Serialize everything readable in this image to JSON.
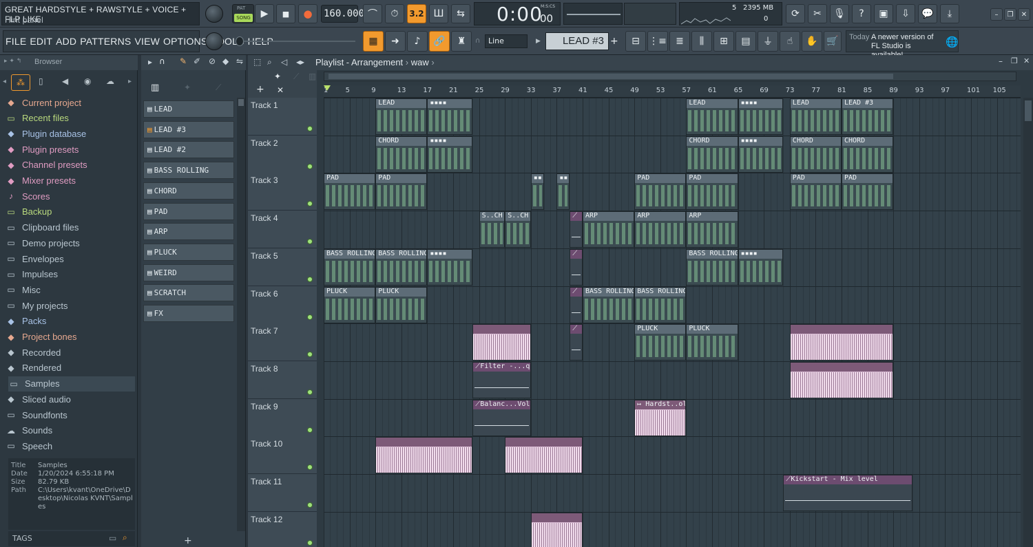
{
  "window": {
    "title": "GREAT HARDSTYLE + RAWSTYLE + VOICE + FLP LIKE",
    "hint": "Hint panel"
  },
  "transport": {
    "pat_label": "PAT",
    "song_label": "SONG",
    "tempo": "160.000",
    "time": "0:00",
    "time_frac": "00",
    "time_unit": "M:S:CS",
    "snap_badge": "3.2",
    "cpu_voices": "5",
    "memory": "2395 MB",
    "memory_sub": "0"
  },
  "menu": [
    "FILE",
    "EDIT",
    "ADD",
    "PATTERNS",
    "VIEW",
    "OPTIONS",
    "TOOLS",
    "HELP"
  ],
  "toolbar": {
    "line_mode": "Line",
    "pattern_selector": "LEAD #3",
    "news_day": "Today",
    "news_text": "A newer version of FL Studio is available!"
  },
  "browser": {
    "header": "Browser",
    "items": [
      {
        "label": "Current project",
        "icon": "project-icon",
        "color": "#e6a88f"
      },
      {
        "label": "Recent files",
        "icon": "folder-icon",
        "color": "#b9d97d"
      },
      {
        "label": "Plugin database",
        "icon": "plug-icon",
        "color": "#a8c2e6"
      },
      {
        "label": "Plugin presets",
        "icon": "plug-icon",
        "color": "#e09cc2"
      },
      {
        "label": "Channel presets",
        "icon": "channel-icon",
        "color": "#e09cc2"
      },
      {
        "label": "Mixer presets",
        "icon": "mixer-icon",
        "color": "#e09cc2"
      },
      {
        "label": "Scores",
        "icon": "note-icon",
        "color": "#e09cc2"
      },
      {
        "label": "Backup",
        "icon": "folder-icon",
        "color": "#b9d97d"
      },
      {
        "label": "Clipboard files",
        "icon": "folder-icon",
        "color": "#b9c6cf"
      },
      {
        "label": "Demo projects",
        "icon": "folder-icon",
        "color": "#b9c6cf"
      },
      {
        "label": "Envelopes",
        "icon": "folder-icon",
        "color": "#b9c6cf"
      },
      {
        "label": "Impulses",
        "icon": "folder-icon",
        "color": "#b9c6cf"
      },
      {
        "label": "Misc",
        "icon": "folder-icon",
        "color": "#b9c6cf"
      },
      {
        "label": "My projects",
        "icon": "folder-icon",
        "color": "#b9c6cf"
      },
      {
        "label": "Packs",
        "icon": "packs-icon",
        "color": "#a8c2e6"
      },
      {
        "label": "Project bones",
        "icon": "bones-icon",
        "color": "#e6a88f"
      },
      {
        "label": "Recorded",
        "icon": "recorded-icon",
        "color": "#b9c6cf"
      },
      {
        "label": "Rendered",
        "icon": "rendered-icon",
        "color": "#b9c6cf"
      },
      {
        "label": "Samples",
        "icon": "folder-icon",
        "color": "#b9c6cf",
        "selected": true
      },
      {
        "label": "Sliced audio",
        "icon": "sliced-icon",
        "color": "#b9c6cf"
      },
      {
        "label": "Soundfonts",
        "icon": "folder-icon",
        "color": "#b9c6cf"
      },
      {
        "label": "Sounds",
        "icon": "cloud-icon",
        "color": "#b9c6cf"
      },
      {
        "label": "Speech",
        "icon": "folder-icon",
        "color": "#b9c6cf"
      }
    ],
    "info": {
      "title_label": "Title",
      "title": "Samples",
      "date_label": "Date",
      "date": "1/20/2024 6:55:18 PM",
      "size_label": "Size",
      "size": "82.79 KB",
      "path_label": "Path",
      "path": "C:\\Users\\kvant\\OneDrive\\Desktop\\Nicolas KVNT\\Samples"
    },
    "tags_label": "TAGS"
  },
  "patterns": [
    "LEAD",
    "LEAD #3",
    "LEAD #2",
    "BASS ROLLING",
    "CHORD",
    "PAD",
    "ARP",
    "PLUCK",
    "WEIRD",
    "SCRATCH",
    "FX"
  ],
  "playlist": {
    "title": "Playlist - Arrangement",
    "breadcrumb": "waw",
    "ruler": [
      "1",
      "5",
      "9",
      "13",
      "17",
      "21",
      "25",
      "29",
      "33",
      "37",
      "41",
      "45",
      "49",
      "53",
      "57",
      "61",
      "65",
      "69",
      "73",
      "77",
      "81",
      "85",
      "89",
      "93",
      "97",
      "101",
      "105"
    ],
    "tracks": [
      "Track 1",
      "Track 2",
      "Track 3",
      "Track 4",
      "Track 5",
      "Track 6",
      "Track 7",
      "Track 8",
      "Track 9",
      "Track 10",
      "Track 11",
      "Track 12"
    ],
    "clips": [
      {
        "track": 0,
        "bar": 9,
        "len": 8,
        "kind": "pattern",
        "label": "LEAD"
      },
      {
        "track": 0,
        "bar": 17,
        "len": 7,
        "kind": "pattern",
        "label": "▪▪▪▪"
      },
      {
        "track": 0,
        "bar": 57,
        "len": 8,
        "kind": "pattern",
        "label": "LEAD"
      },
      {
        "track": 0,
        "bar": 65,
        "len": 7,
        "kind": "pattern",
        "label": "▪▪▪▪"
      },
      {
        "track": 0,
        "bar": 73,
        "len": 8,
        "kind": "pattern",
        "label": "LEAD"
      },
      {
        "track": 0,
        "bar": 81,
        "len": 8,
        "kind": "pattern",
        "label": "LEAD #3"
      },
      {
        "track": 1,
        "bar": 9,
        "len": 8,
        "kind": "pattern",
        "label": "CHORD"
      },
      {
        "track": 1,
        "bar": 17,
        "len": 7,
        "kind": "pattern",
        "label": "▪▪▪▪"
      },
      {
        "track": 1,
        "bar": 57,
        "len": 8,
        "kind": "pattern",
        "label": "CHORD"
      },
      {
        "track": 1,
        "bar": 65,
        "len": 7,
        "kind": "pattern",
        "label": "▪▪▪▪"
      },
      {
        "track": 1,
        "bar": 73,
        "len": 8,
        "kind": "pattern",
        "label": "CHORD"
      },
      {
        "track": 1,
        "bar": 81,
        "len": 8,
        "kind": "pattern",
        "label": "CHORD"
      },
      {
        "track": 2,
        "bar": 1,
        "len": 8,
        "kind": "pattern",
        "label": "PAD"
      },
      {
        "track": 2,
        "bar": 9,
        "len": 8,
        "kind": "pattern",
        "label": "PAD"
      },
      {
        "track": 2,
        "bar": 33,
        "len": 2,
        "kind": "pattern",
        "label": "▪▪"
      },
      {
        "track": 2,
        "bar": 37,
        "len": 2,
        "kind": "pattern",
        "label": "▪▪"
      },
      {
        "track": 2,
        "bar": 49,
        "len": 8,
        "kind": "pattern",
        "label": "PAD"
      },
      {
        "track": 2,
        "bar": 57,
        "len": 8,
        "kind": "pattern",
        "label": "PAD"
      },
      {
        "track": 2,
        "bar": 73,
        "len": 8,
        "kind": "pattern",
        "label": "PAD"
      },
      {
        "track": 2,
        "bar": 81,
        "len": 8,
        "kind": "pattern",
        "label": "PAD"
      },
      {
        "track": 3,
        "bar": 25,
        "len": 4,
        "kind": "pattern",
        "label": "S..CH"
      },
      {
        "track": 3,
        "bar": 29,
        "len": 4,
        "kind": "pattern",
        "label": "S..CH"
      },
      {
        "track": 3,
        "bar": 39,
        "len": 2,
        "kind": "auto",
        "label": "⟋"
      },
      {
        "track": 3,
        "bar": 41,
        "len": 8,
        "kind": "pattern",
        "label": "ARP"
      },
      {
        "track": 3,
        "bar": 49,
        "len": 8,
        "kind": "pattern",
        "label": "ARP"
      },
      {
        "track": 3,
        "bar": 57,
        "len": 8,
        "kind": "pattern",
        "label": "ARP"
      },
      {
        "track": 4,
        "bar": 1,
        "len": 8,
        "kind": "pattern",
        "label": "BASS ROLLING"
      },
      {
        "track": 4,
        "bar": 9,
        "len": 8,
        "kind": "pattern",
        "label": "BASS ROLLING"
      },
      {
        "track": 4,
        "bar": 17,
        "len": 7,
        "kind": "pattern",
        "label": "▪▪▪▪"
      },
      {
        "track": 4,
        "bar": 39,
        "len": 2,
        "kind": "auto",
        "label": "⟋"
      },
      {
        "track": 4,
        "bar": 57,
        "len": 8,
        "kind": "pattern",
        "label": "BASS ROLLING"
      },
      {
        "track": 4,
        "bar": 65,
        "len": 7,
        "kind": "pattern",
        "label": "▪▪▪▪"
      },
      {
        "track": 5,
        "bar": 1,
        "len": 8,
        "kind": "pattern",
        "label": "PLUCK"
      },
      {
        "track": 5,
        "bar": 9,
        "len": 8,
        "kind": "pattern",
        "label": "PLUCK"
      },
      {
        "track": 5,
        "bar": 39,
        "len": 2,
        "kind": "auto",
        "label": "⟋"
      },
      {
        "track": 5,
        "bar": 41,
        "len": 8,
        "kind": "pattern",
        "label": "BASS ROLLING"
      },
      {
        "track": 5,
        "bar": 49,
        "len": 8,
        "kind": "pattern",
        "label": "BASS ROLLING"
      },
      {
        "track": 6,
        "bar": 24,
        "len": 9,
        "kind": "audio",
        "label": ""
      },
      {
        "track": 6,
        "bar": 39,
        "len": 2,
        "kind": "auto",
        "label": "⟋"
      },
      {
        "track": 6,
        "bar": 49,
        "len": 8,
        "kind": "pattern",
        "label": "PLUCK"
      },
      {
        "track": 6,
        "bar": 57,
        "len": 8,
        "kind": "pattern",
        "label": "PLUCK"
      },
      {
        "track": 6,
        "bar": 73,
        "len": 16,
        "kind": "audio",
        "label": ""
      },
      {
        "track": 7,
        "bar": 24,
        "len": 9,
        "kind": "auto",
        "label": "⟋Filter -...quency"
      },
      {
        "track": 7,
        "bar": 73,
        "len": 16,
        "kind": "audio",
        "label": ""
      },
      {
        "track": 8,
        "bar": 24,
        "len": 9,
        "kind": "auto",
        "label": "⟋Balanc...Volume"
      },
      {
        "track": 8,
        "bar": 49,
        "len": 8,
        "kind": "audio",
        "label": "↦ Hardst..ol FLP"
      },
      {
        "track": 9,
        "bar": 9,
        "len": 15,
        "kind": "audio",
        "label": ""
      },
      {
        "track": 9,
        "bar": 29,
        "len": 12,
        "kind": "audio",
        "label": ""
      },
      {
        "track": 10,
        "bar": 72,
        "len": 20,
        "kind": "auto",
        "label": "⟋Kickstart - Mix level"
      },
      {
        "track": 11,
        "bar": 33,
        "len": 8,
        "kind": "audio",
        "label": ""
      }
    ]
  },
  "colors": {
    "accent_orange": "#f29a2e",
    "clip_header": "#5d6c77",
    "note_green": "#a0e6aa",
    "audio_pink": "#d9bcd4"
  }
}
